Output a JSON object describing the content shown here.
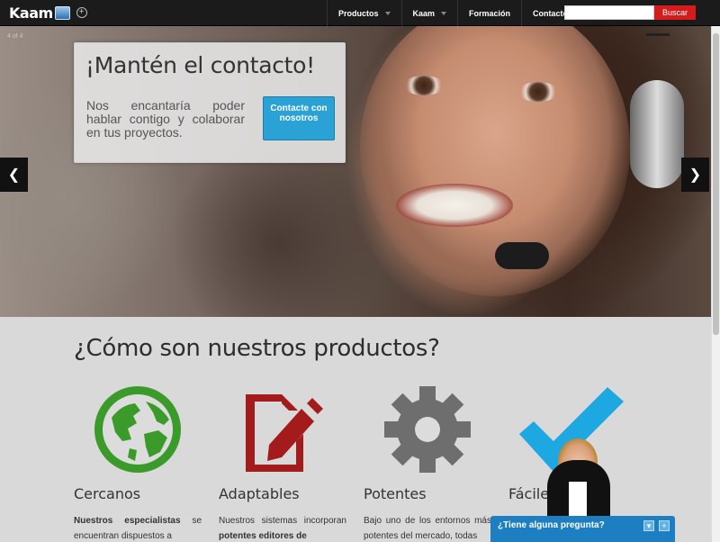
{
  "navbar": {
    "logo_text": "Kaam",
    "menu": [
      {
        "label": "Productos"
      },
      {
        "label": "Kaam"
      },
      {
        "label": "Formación"
      },
      {
        "label": "Contacto"
      }
    ],
    "search_placeholder": "",
    "search_button": "Buscar"
  },
  "hero": {
    "slide_counter": "4 of 4",
    "title": "¡Mantén el contacto!",
    "text": "Nos encantaría poder hablar contigo y colaborar en tus proyectos.",
    "button_label": "Contacte con nosotros",
    "prev_arrow": "❮",
    "next_arrow": "❯"
  },
  "products": {
    "heading": "¿Cómo son nuestros productos?",
    "items": [
      {
        "title": "Cercanos",
        "lead": "Nuestros especialistas",
        "text": " se encuentran dispuestos a",
        "icon": "globe-icon"
      },
      {
        "title": "Adaptables",
        "lead": "",
        "text": "Nuestros sistemas incorporan ",
        "bold_tail": "potentes editores de",
        "icon": "document-edit-icon"
      },
      {
        "title": "Potentes",
        "lead": "",
        "text": "Bajo uno de los entornos más potentes del mercado, todas",
        "icon": "gear-icon"
      },
      {
        "title": "Fáciles",
        "lead": "",
        "text": "",
        "icon": "checkmark-icon"
      }
    ]
  },
  "chat": {
    "title": "¿Tiene alguna pregunta?",
    "minimize_label": "▾",
    "expand_label": "+"
  },
  "colors": {
    "accent_red": "#d41c1c",
    "button_blue": "#2aa2d6",
    "chat_blue": "#1d7fc2",
    "globe_green": "#3a9b2a",
    "doc_red": "#a31b1b",
    "gear_gray": "#6e6e6e",
    "check_blue": "#1ea8e2"
  }
}
